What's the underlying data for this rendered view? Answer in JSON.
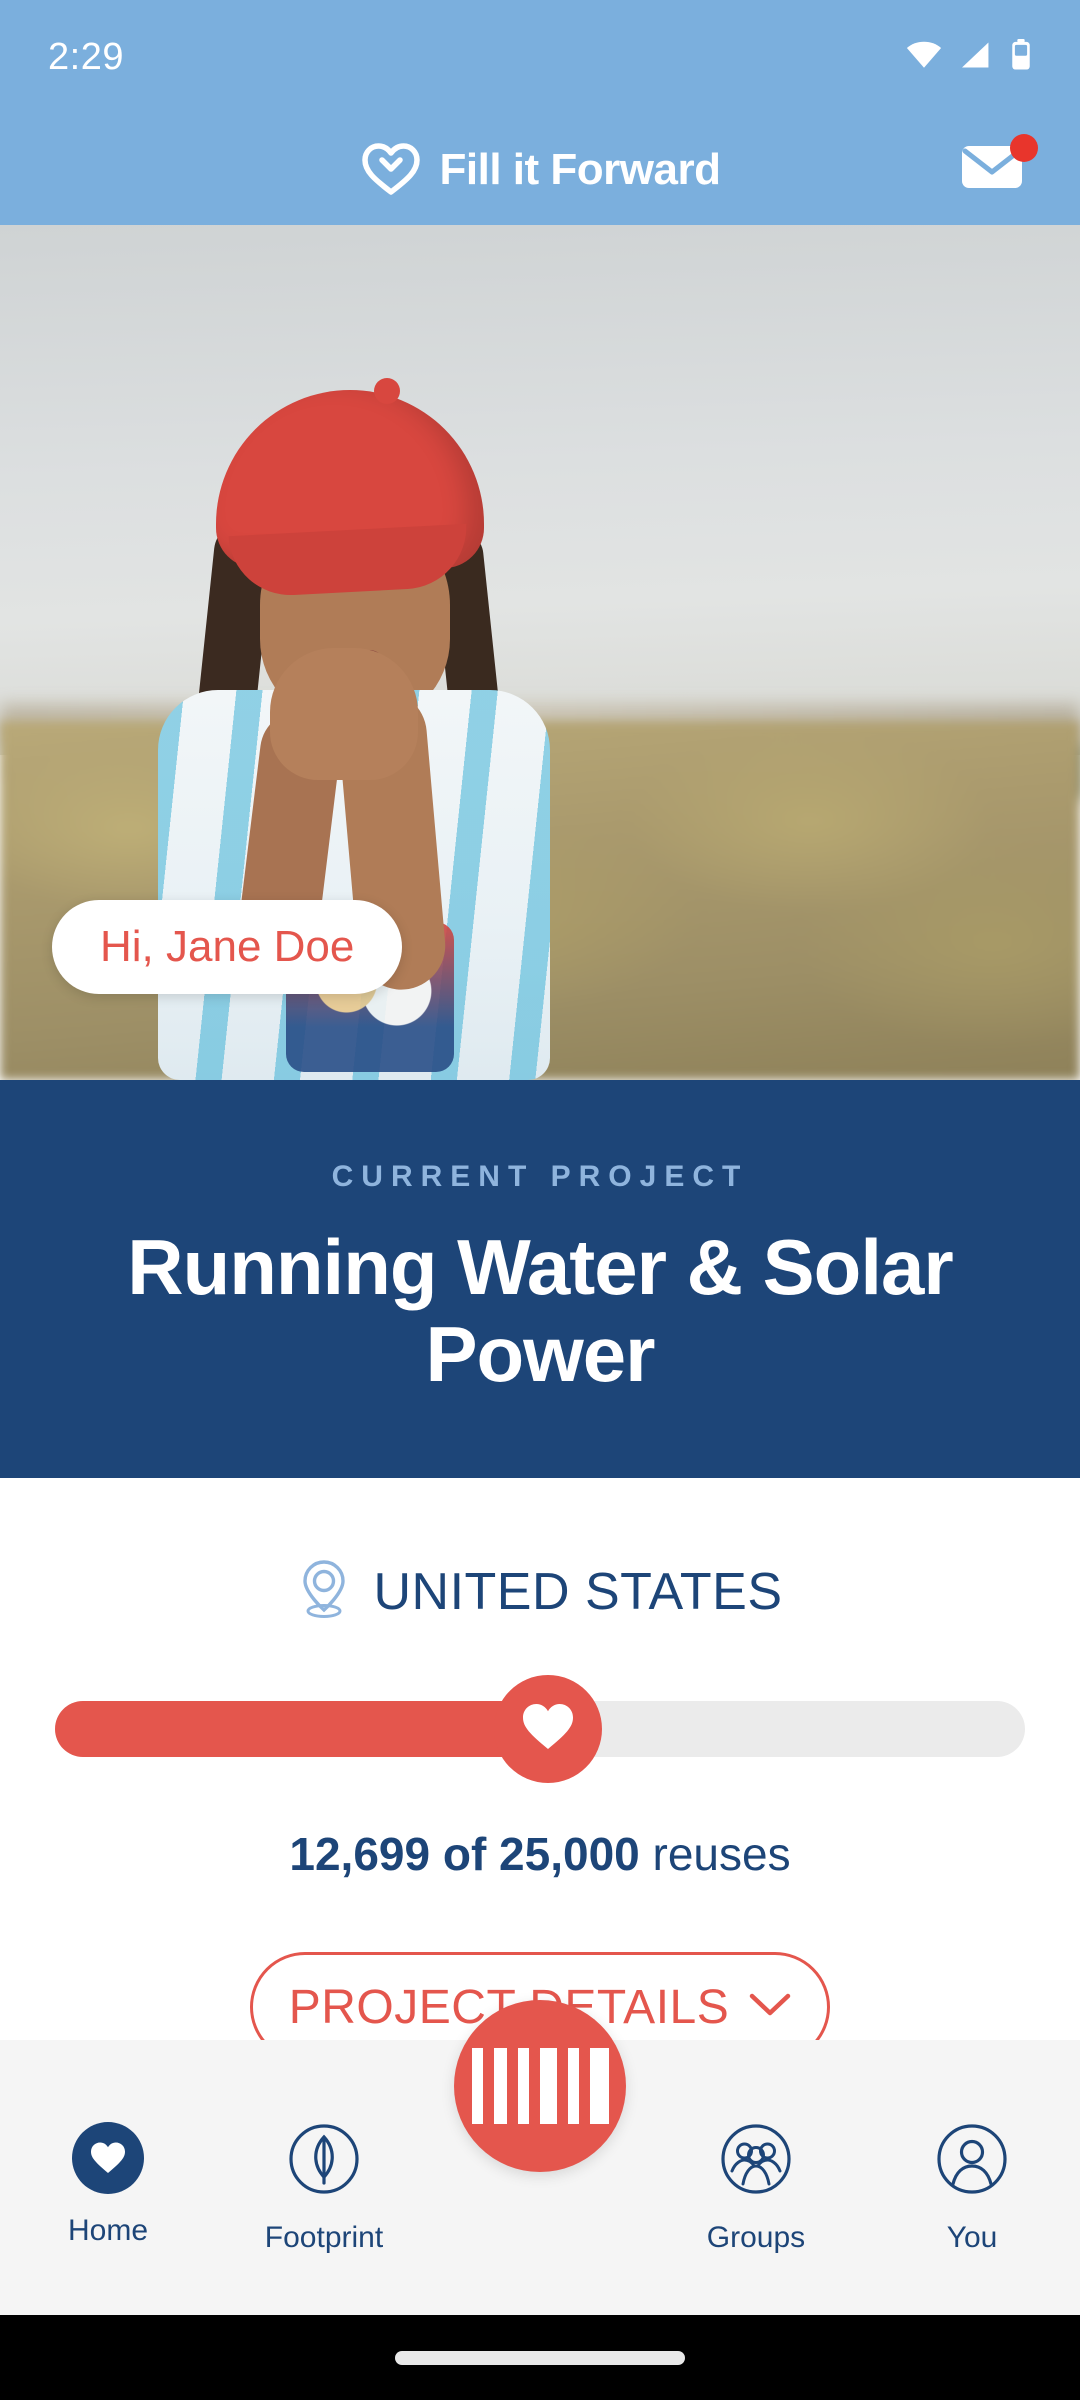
{
  "status_bar": {
    "time": "2:29",
    "icons": [
      "wifi-icon",
      "cellular-signal-icon",
      "battery-icon"
    ]
  },
  "app_bar": {
    "brand_name": "Fill it Forward",
    "logo_icon": "heart-recycle-icon",
    "mail_icon": "envelope-icon",
    "mail_has_unread_badge": true
  },
  "hero": {
    "greeting": "Hi, Jane Doe",
    "image_description": "child in red cap standing in a dry grass field"
  },
  "banner": {
    "eyebrow": "CURRENT PROJECT",
    "title": "Running Water & Solar Power"
  },
  "project": {
    "location_icon": "location-pin-icon",
    "location": "UNITED STATES",
    "progress": {
      "current_label": "12,699 of 25,000",
      "unit_label": "reuses",
      "current": 12699,
      "goal": 25000,
      "percent": 50.8,
      "thumb_icon": "heart-icon"
    },
    "details_button": {
      "label": "PROJECT DETAILS",
      "chevron_icon": "chevron-down-icon"
    }
  },
  "bottom_nav": {
    "items": [
      {
        "label": "Home",
        "icon": "heart-icon",
        "active": true
      },
      {
        "label": "Footprint",
        "icon": "leaf-icon",
        "active": false
      },
      {
        "label": "Groups",
        "icon": "people-group-icon",
        "active": false
      },
      {
        "label": "You",
        "icon": "person-icon",
        "active": false
      }
    ],
    "scan_button": {
      "icon": "barcode-icon",
      "label": ""
    }
  },
  "colors": {
    "header_blue": "#7bafdd",
    "banner_navy": "#1d4578",
    "accent_coral": "#e4564d",
    "track_grey": "#ebebeb",
    "nav_bg": "#f5f5f5",
    "badge_red": "#e8352c"
  }
}
